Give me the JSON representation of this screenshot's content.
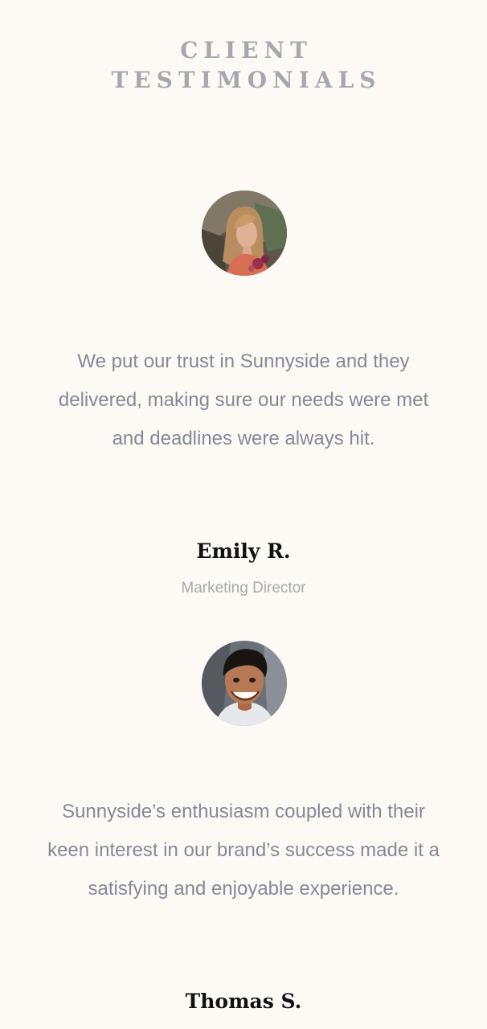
{
  "section": {
    "title_line1": "CLIENT",
    "title_line2": "TESTIMONIALS"
  },
  "testimonials": [
    {
      "avatar_icon": "woman-portrait-avatar",
      "quote": "We put our trust in Sunnyside and they delivered, making sure our needs were met and deadlines were always hit.",
      "name": "Emily R.",
      "role": "Marketing Director"
    },
    {
      "avatar_icon": "man-portrait-avatar",
      "quote": "Sunnyside’s enthusiasm coupled with their keen interest in our brand’s success made it a satisfying and enjoyable experience.",
      "name": "Thomas S.",
      "role": ""
    }
  ],
  "colors": {
    "background": "#fdfaf6",
    "title": "#a6a8ad",
    "quote": "#858997",
    "name": "#111111",
    "role": "#a7a9ae"
  }
}
